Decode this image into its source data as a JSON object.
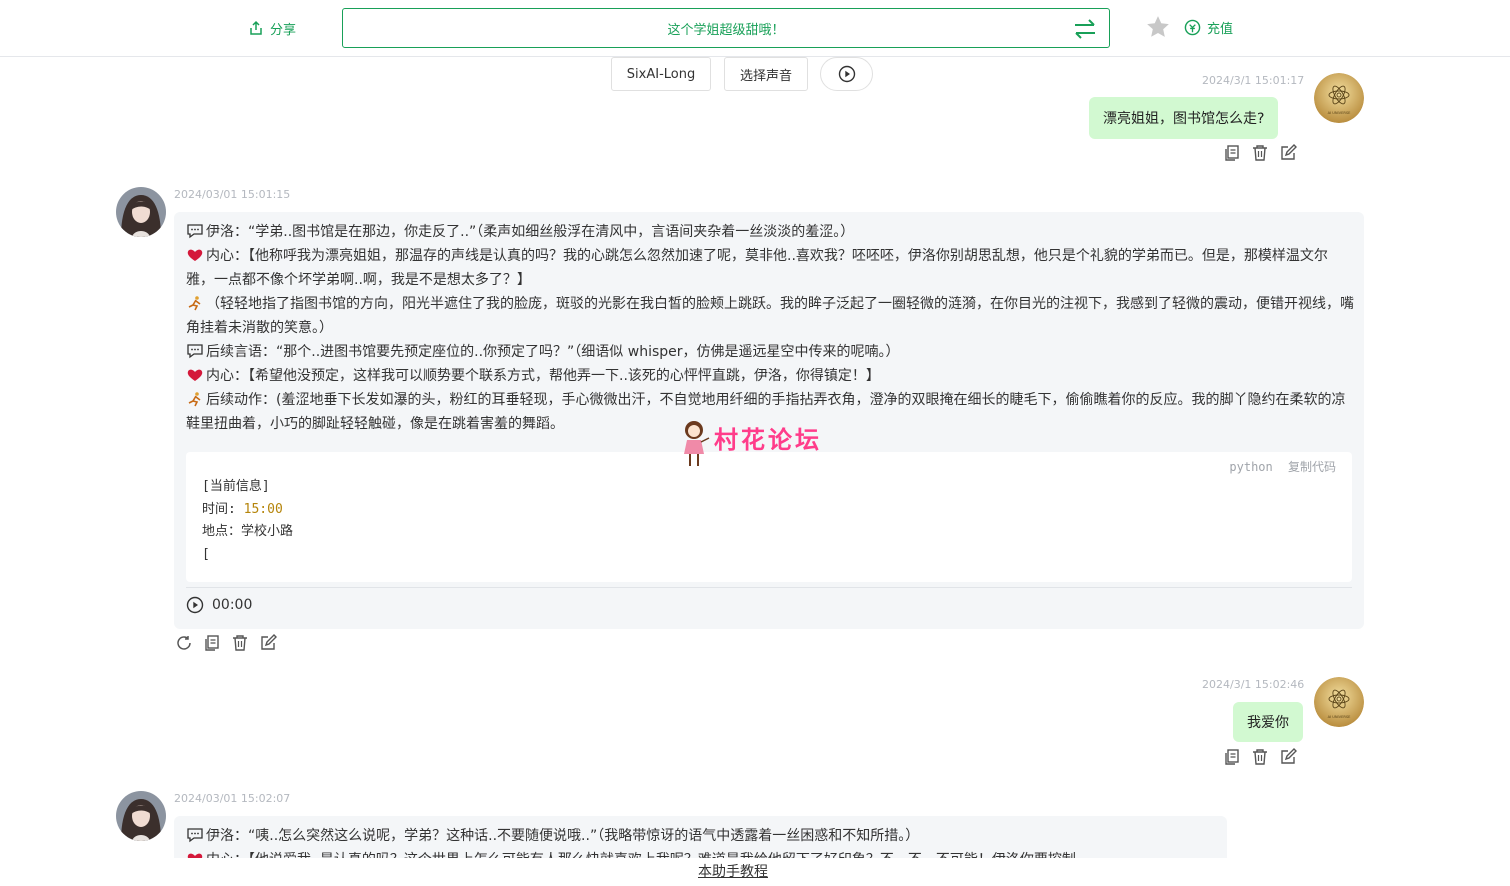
{
  "header": {
    "share_label": "分享",
    "title": "这个学姐超级甜哦！",
    "recharge_label": "充值",
    "accent": "#18a058"
  },
  "model_bar": {
    "model_label": "SixAI-Long",
    "voice_label": "选择声音"
  },
  "messages": [
    {
      "role": "user",
      "timestamp": "2024/3/1 15:01:17",
      "text": "漂亮姐姐，图书馆怎么走?"
    },
    {
      "role": "assistant",
      "timestamp": "2024/03/01 15:01:15",
      "lines": [
        "伊洛：“学弟..图书馆是在那边，你走反了..”（柔声如细丝般浮在清风中，言语间夹杂着一丝淡淡的羞涩。）",
        "内心：【他称呼我为漂亮姐姐，那温存的声线是认真的吗？我的心跳怎么忽然加速了呢，莫非他..喜欢我？呸呸呸，伊洛你别胡思乱想，他只是个礼貌的学弟而已。但是，那模样温文尔雅，一点都不像个坏学弟啊..啊，我是不是想太多了？】",
        "（轻轻地指了指图书馆的方向，阳光半遮住了我的脸庞，斑驳的光影在我白皙的脸颊上跳跃。我的眸子泛起了一圈轻微的涟漪，在你目光的注视下，我感到了轻微的震动，便错开视线，嘴角挂着未消散的笑意。）",
        "后续言语：“那个..进图书馆要先预定座位的..你预定了吗？”（细语似 whisper，仿佛是遥远星空中传来的呢喃。）",
        "内心：【希望他没预定，这样我可以顺势要个联系方式，帮他弄一下..该死的心怦怦直跳，伊洛，你得镇定！】",
        "后续动作：(羞涩地垂下长发如瀑的头，粉红的耳垂轻现，手心微微出汗，不自觉地用纤细的手指拈弄衣角，澄净的双眼掩在细长的睫毛下，偷偷瞧着你的反应。我的脚丫隐约在柔软的凉鞋里扭曲着，小巧的脚趾轻轻触碰，像是在跳着害羞的舞蹈。"
      ],
      "code": {
        "lang": "python",
        "copy_label": "复制代码",
        "line1": "[当前信息]",
        "time_key": "时间:",
        "time_val": "15:00",
        "line3": "地点：学校小路",
        "line4": "["
      },
      "audio_time": "00:00"
    },
    {
      "role": "user",
      "timestamp": "2024/3/1 15:02:46",
      "text": "我爱你"
    },
    {
      "role": "assistant",
      "timestamp": "2024/03/01 15:02:07",
      "lines": [
        "伊洛：“咦..怎么突然这么说呢，学弟？这种话..不要随便说哦..”（我略带惊讶的语气中透露着一丝困惑和不知所措。）",
        "内心：【他说爱我..是认真的吗？这个世界上怎么可能有人那么快就喜欢上我呢？难道是我给他留下了好印象？不，不，不可能！伊洛你要控制"
      ]
    }
  ],
  "user_avatar_text": "AI UNIVERSE",
  "watermark": "村花论坛",
  "footer": {
    "tutorial_label": "本助手教程"
  }
}
